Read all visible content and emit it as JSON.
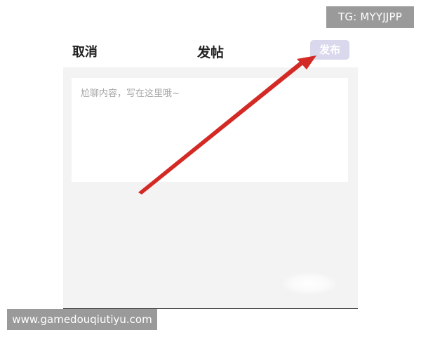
{
  "watermarks": {
    "tg": "TG: MYYJJPP",
    "site": "www.gamedouqiutiyu.com"
  },
  "header": {
    "cancel_label": "取消",
    "title": "发帖",
    "publish_label": "发布"
  },
  "editor": {
    "placeholder": "尬聊内容，写在这里哦~",
    "value": ""
  },
  "colors": {
    "publish_button_bg": "#d9d8ec",
    "annotation_arrow": "#d42a26",
    "watermark_bg": "#9a9a9a",
    "body_bg": "#f3f3f3"
  },
  "icons": {
    "annotation": "red-arrow-icon"
  }
}
